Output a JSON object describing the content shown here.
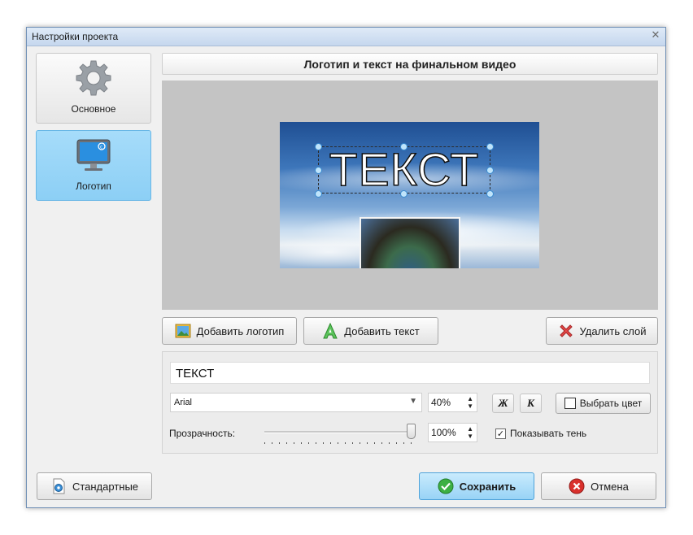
{
  "window": {
    "title": "Настройки проекта",
    "close_glyph": "✕"
  },
  "sidebar": {
    "items": [
      {
        "label": "Основное",
        "icon": "gear-icon",
        "active": false
      },
      {
        "label": "Логотип",
        "icon": "monitor-icon",
        "active": true
      }
    ]
  },
  "header": {
    "title": "Логотип и текст на финальном видео"
  },
  "preview": {
    "overlay_text": "ТЕКСТ"
  },
  "toolbar": {
    "add_logo": "Добавить логотип",
    "add_text": "Добавить текст",
    "delete_layer": "Удалить слой"
  },
  "editor": {
    "text_value": "ТЕКСТ",
    "font": "Arial",
    "font_size": "40%",
    "bold_label": "Ж",
    "italic_label": "К",
    "color_button": "Выбрать цвет",
    "opacity_label": "Прозрачность:",
    "opacity_value": "100%",
    "opacity_fraction": 1.0,
    "shadow_label": "Показывать тень",
    "shadow_checked": true
  },
  "footer": {
    "defaults": "Стандартные",
    "save": "Сохранить",
    "cancel": "Отмена"
  },
  "colors": {
    "accent": "#8ccff5",
    "primary_button": "#98d3f6",
    "delete_icon": "#e54848",
    "save_icon": "#3cb043",
    "cancel_icon": "#d9302c"
  }
}
